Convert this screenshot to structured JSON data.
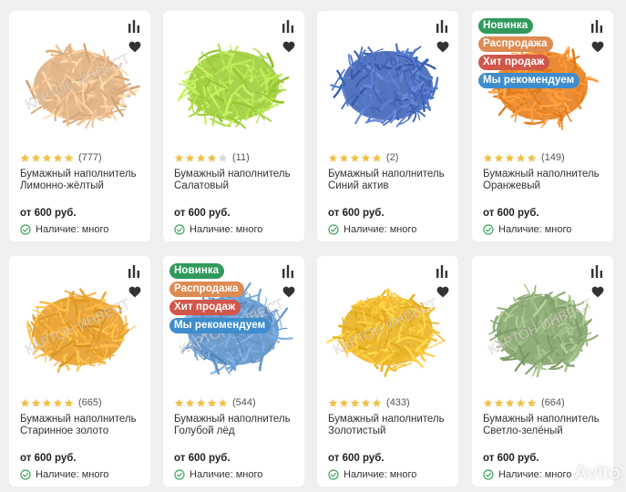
{
  "icons": {
    "compare": "compare-bars-icon",
    "favorite": "heart-icon",
    "availability": "check-circle-icon"
  },
  "colors": {
    "star": "#f2c14e",
    "star_empty": "#d8d8d8",
    "badge_new": "#2f9a5c",
    "badge_sale": "#de8b52",
    "badge_hit": "#d0574a",
    "badge_rec": "#3f8dcc",
    "check": "#3aa55d"
  },
  "badge_labels": {
    "new": "Новинка",
    "sale": "Распродажа",
    "hit": "Хит продаж",
    "rec": "Мы рекомендуем"
  },
  "watermark": "Avito",
  "products": [
    {
      "title": "Бумажный наполнитель Лимонно-жёлтый",
      "reviews": "(777)",
      "rating": 5,
      "price": "от 600 руб.",
      "stock": "Наличие: много",
      "color": "#e8b98a",
      "badges": false,
      "logo": "КАРТОН ИНВЕСТ"
    },
    {
      "title": "Бумажный наполнитель Салатовый",
      "reviews": "(11)",
      "rating": 4,
      "price": "от 600 руб.",
      "stock": "Наличие: много",
      "color": "#a9d645",
      "badges": false,
      "logo": ""
    },
    {
      "title": "Бумажный наполнитель Синий актив",
      "reviews": "(2)",
      "rating": 5,
      "price": "от 600 руб.",
      "stock": "Наличие: много",
      "color": "#4b6fc0",
      "badges": false,
      "logo": ""
    },
    {
      "title": "Бумажный наполнитель Оранжевый",
      "reviews": "(149)",
      "rating": 5,
      "price": "от 600 руб.",
      "stock": "Наличие: много",
      "color": "#f08a2a",
      "badges": true,
      "logo": ""
    },
    {
      "title": "Бумажный наполнитель Старинное золото",
      "reviews": "(665)",
      "rating": 5,
      "price": "от 600 руб.",
      "stock": "Наличие: много",
      "color": "#f0a835",
      "badges": false,
      "logo": "КАРТОН ИНВЕСТ"
    },
    {
      "title": "Бумажный наполнитель Голубой лёд",
      "reviews": "(544)",
      "rating": 5,
      "price": "от 600 руб.",
      "stock": "Наличие: много",
      "color": "#6a9bd0",
      "badges": true,
      "logo": "КАРТОН ИНВЕСТ"
    },
    {
      "title": "Бумажный наполнитель Золотистый",
      "reviews": "(433)",
      "rating": 5,
      "price": "от 600 руб.",
      "stock": "Наличие: много",
      "color": "#f3bc2e",
      "badges": false,
      "logo": "КАРТОН ИНВЕСТ"
    },
    {
      "title": "Бумажный наполнитель Светло-зелёный",
      "reviews": "(664)",
      "rating": 5,
      "price": "от 600 руб.",
      "stock": "Наличие: много",
      "color": "#8fae78",
      "badges": false,
      "logo": "КАРТОН ИНВЕСТ"
    }
  ]
}
